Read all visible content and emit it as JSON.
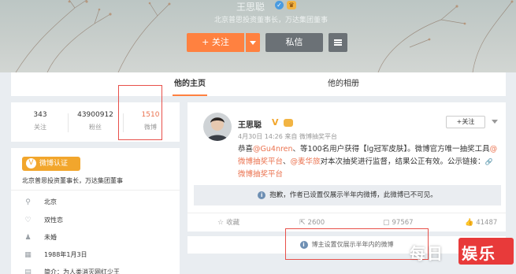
{
  "profile": {
    "name": "王思聪",
    "description": "北京普思投资董事长，万达集团董事",
    "follow_label": "+ 关注",
    "message_label": "私信"
  },
  "tabs": [
    {
      "label": "他的主页",
      "active": true
    },
    {
      "label": "他的相册",
      "active": false
    }
  ],
  "stats": [
    {
      "value": "343",
      "label": "关注"
    },
    {
      "value": "43900912",
      "label": "粉丝"
    },
    {
      "value": "1510",
      "label": "微博"
    }
  ],
  "certification": {
    "badge_label": "微博认证",
    "description": "北京普思投资董事长，万达集团董事"
  },
  "info": [
    {
      "icon": "location-icon",
      "text": "北京"
    },
    {
      "icon": "heart-icon",
      "text": "双性恋"
    },
    {
      "icon": "user-icon",
      "text": "未婚"
    },
    {
      "icon": "calendar-icon",
      "text": "1988年1月3日"
    },
    {
      "icon": "profile-icon",
      "text": "简介：为人类消灭网红少王"
    }
  ],
  "post": {
    "author": "王思聪",
    "verified_mark": "V",
    "time": "4月30日 14:26 来自 微博抽奖平台",
    "follow_label": "+关注",
    "text_parts": [
      {
        "t": "恭喜",
        "link": false
      },
      {
        "t": "@Gu4nren",
        "link": true
      },
      {
        "t": "、等100名用户获得【lg冠军皮肤】。微博官方唯一抽奖工具",
        "link": false
      },
      {
        "t": "@微博抽奖平台",
        "link": true
      },
      {
        "t": "、",
        "link": false
      },
      {
        "t": "@麦华旅",
        "link": true
      },
      {
        "t": "对本次抽奖进行监督，结果公正有效。公示链接：",
        "link": false
      },
      {
        "t": "微博抽奖平台",
        "link": true
      }
    ],
    "notice": "抱歉，作者已设置仅展示半年内微博，此微博已不可见。",
    "actions": [
      {
        "icon": "star-icon",
        "label": "收藏"
      },
      {
        "icon": "share-icon",
        "label": "2600"
      },
      {
        "icon": "comment-icon",
        "label": "97567"
      },
      {
        "icon": "like-icon",
        "label": "41487"
      }
    ]
  },
  "footer_notice": "博主设置仅展示半年内的微博",
  "watermark": {
    "prefix": "每日",
    "boxed": "娱乐"
  },
  "colors": {
    "accent": "#ff8140",
    "link": "#eb7350",
    "annotation": "#e8504a",
    "watermark_red": "#e83a3a"
  }
}
